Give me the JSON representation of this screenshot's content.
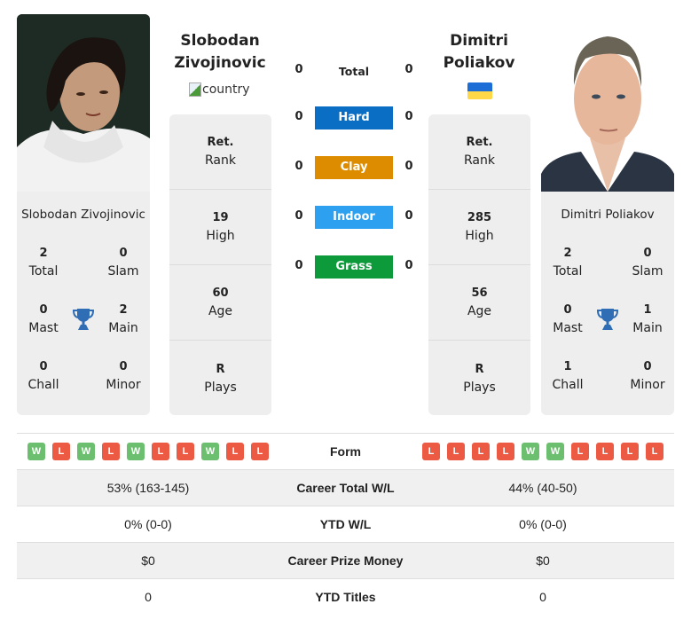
{
  "player_left": {
    "name_line1": "Slobodan",
    "name_line2": "Zivojinovic",
    "full_name": "Slobodan Zivojinovic",
    "country_alt": "country",
    "photo_label": "Slobodan Zivojinovic photo",
    "rank": {
      "value": "Ret.",
      "label": "Rank"
    },
    "high": {
      "value": "19",
      "label": "High"
    },
    "age": {
      "value": "60",
      "label": "Age"
    },
    "plays": {
      "value": "R",
      "label": "Plays"
    },
    "titles": {
      "total": {
        "value": "2",
        "label": "Total"
      },
      "slam": {
        "value": "0",
        "label": "Slam"
      },
      "mast": {
        "value": "0",
        "label": "Mast"
      },
      "main": {
        "value": "2",
        "label": "Main"
      },
      "chall": {
        "value": "0",
        "label": "Chall"
      },
      "minor": {
        "value": "0",
        "label": "Minor"
      }
    },
    "form": [
      "W",
      "L",
      "W",
      "L",
      "W",
      "L",
      "L",
      "W",
      "L",
      "L"
    ],
    "career_total_wl": "53% (163-145)",
    "ytd_wl": "0% (0-0)",
    "career_prize_money": "$0",
    "ytd_titles": "0"
  },
  "player_right": {
    "name_line1": "Dimitri",
    "name_line2": "Poliakov",
    "full_name": "Dimitri Poliakov",
    "country_flag": "Ukraine",
    "flag_colors": [
      "#1c6ed6",
      "#ffd84a"
    ],
    "photo_label": "Dimitri Poliakov photo",
    "rank": {
      "value": "Ret.",
      "label": "Rank"
    },
    "high": {
      "value": "285",
      "label": "High"
    },
    "age": {
      "value": "56",
      "label": "Age"
    },
    "plays": {
      "value": "R",
      "label": "Plays"
    },
    "titles": {
      "total": {
        "value": "2",
        "label": "Total"
      },
      "slam": {
        "value": "0",
        "label": "Slam"
      },
      "mast": {
        "value": "0",
        "label": "Mast"
      },
      "main": {
        "value": "1",
        "label": "Main"
      },
      "chall": {
        "value": "1",
        "label": "Chall"
      },
      "minor": {
        "value": "0",
        "label": "Minor"
      }
    },
    "form": [
      "L",
      "L",
      "L",
      "L",
      "W",
      "W",
      "L",
      "L",
      "L",
      "L"
    ],
    "career_total_wl": "44% (40-50)",
    "ytd_wl": "0% (0-0)",
    "career_prize_money": "$0",
    "ytd_titles": "0"
  },
  "h2h": {
    "total": {
      "label": "Total",
      "left": "0",
      "right": "0"
    },
    "surfaces": [
      {
        "label": "Hard",
        "left": "0",
        "right": "0",
        "color": "#0a6ec4"
      },
      {
        "label": "Clay",
        "left": "0",
        "right": "0",
        "color": "#dd8c00"
      },
      {
        "label": "Indoor",
        "left": "0",
        "right": "0",
        "color": "#2ea0f0"
      },
      {
        "label": "Grass",
        "left": "0",
        "right": "0",
        "color": "#0c9a3a"
      }
    ]
  },
  "table": {
    "form_label": "Form",
    "career_total_wl_label": "Career Total W/L",
    "ytd_wl_label": "YTD W/L",
    "career_prize_money_label": "Career Prize Money",
    "ytd_titles_label": "YTD Titles"
  },
  "colors": {
    "win": "#6bbf6e",
    "loss": "#ec5a44",
    "trophy": "#2f6db5",
    "card_bg": "#eeeeee"
  }
}
